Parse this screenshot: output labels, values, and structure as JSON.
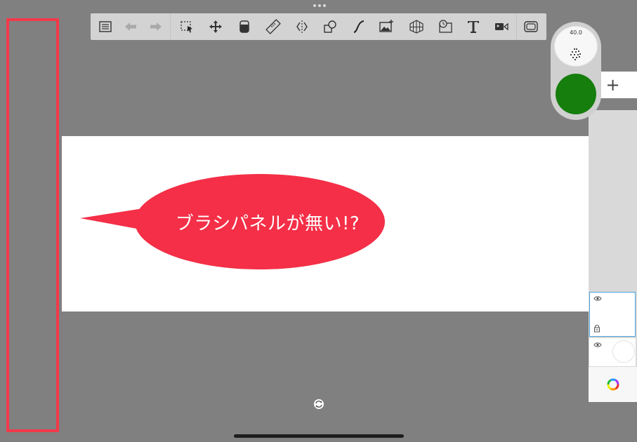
{
  "toolbar": {
    "tools": [
      {
        "name": "menu-list-icon"
      },
      {
        "name": "undo-arrow-icon"
      },
      {
        "name": "redo-arrow-icon"
      },
      {
        "name": "selection-icon"
      },
      {
        "name": "transform-move-icon"
      },
      {
        "name": "fill-bucket-icon"
      },
      {
        "name": "ruler-icon"
      },
      {
        "name": "symmetry-icon"
      },
      {
        "name": "shapes-icon"
      },
      {
        "name": "stroke-curve-icon"
      },
      {
        "name": "add-image-icon"
      },
      {
        "name": "perspective-grid-icon"
      },
      {
        "name": "time-lapse-icon"
      },
      {
        "name": "text-tool-icon"
      },
      {
        "name": "video-record-icon"
      },
      {
        "name": "fullscreen-icon"
      }
    ]
  },
  "canvas": {
    "callout_text": "ブラシパネルが無い!?",
    "callout_color": "#f42f47",
    "frame_color": "#f2394a"
  },
  "brush_puck": {
    "size_value": "40.0",
    "current_color": "#157e0c"
  },
  "layers": {
    "add_label": "+"
  }
}
